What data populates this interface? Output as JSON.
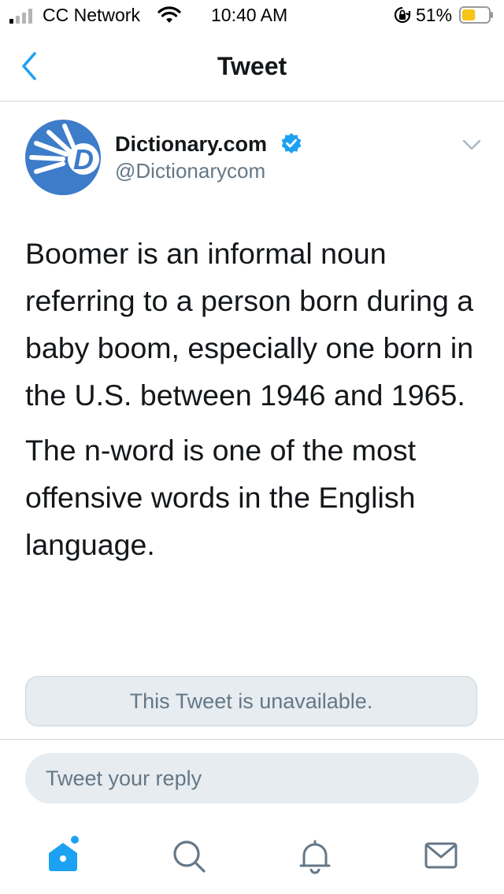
{
  "status_bar": {
    "carrier": "CC Network",
    "time": "10:40 AM",
    "battery_percent": "51%",
    "battery_level": 0.51
  },
  "nav": {
    "title": "Tweet"
  },
  "tweet": {
    "author_name": "Dictionary.com",
    "author_handle": "@Dictionarycom",
    "verified": true,
    "paragraphs": [
      "Boomer is an informal noun referring to a person born during a baby boom, especially one born in the U.S. between 1946 and 1965.",
      "The n-word is one of the most offensive words in the English language."
    ],
    "quoted_unavailable": "This Tweet is unavailable."
  },
  "reply": {
    "placeholder": "Tweet your reply"
  },
  "tabs": [
    {
      "name": "home",
      "icon": "home-icon",
      "active": true,
      "has_notification_dot": true
    },
    {
      "name": "search",
      "icon": "search-icon",
      "active": false
    },
    {
      "name": "notifications",
      "icon": "bell-icon",
      "active": false
    },
    {
      "name": "messages",
      "icon": "mail-icon",
      "active": false
    }
  ],
  "colors": {
    "accent": "#1da1f2",
    "text_primary": "#14171a",
    "text_secondary": "#657786",
    "gray_fill": "#e6ecf0",
    "divider": "#d3d8dc",
    "battery_yellow": "#f5c518",
    "avatar_blue": "#3d7cc9"
  }
}
